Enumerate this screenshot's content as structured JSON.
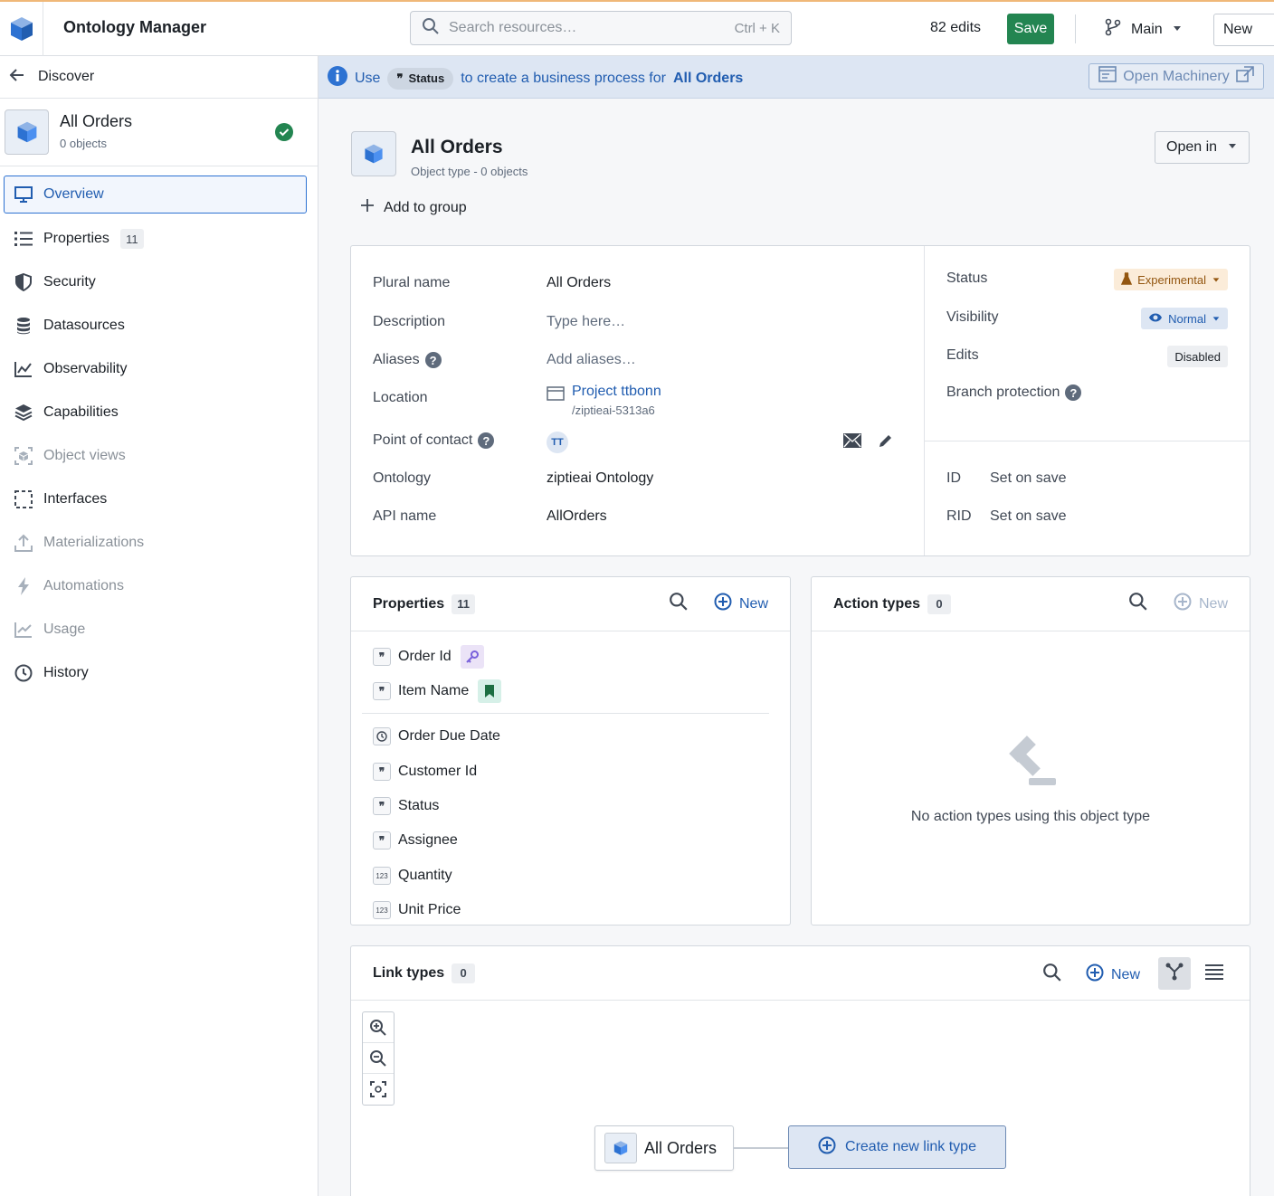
{
  "topbar": {
    "app_title": "Ontology Manager",
    "search_placeholder": "Search resources…",
    "search_shortcut": "Ctrl + K",
    "edits_count": "82 edits",
    "save_label": "Save",
    "branch_label": "Main",
    "new_label": "New"
  },
  "sidebar": {
    "back_label": "Discover",
    "object_name": "All Orders",
    "object_count": "0 objects",
    "items": [
      {
        "label": "Overview",
        "icon": "monitor-icon",
        "state": "active"
      },
      {
        "label": "Properties",
        "icon": "list-icon",
        "badge": "11"
      },
      {
        "label": "Security",
        "icon": "shield-icon"
      },
      {
        "label": "Datasources",
        "icon": "database-icon"
      },
      {
        "label": "Observability",
        "icon": "chart-icon"
      },
      {
        "label": "Capabilities",
        "icon": "layers-icon"
      },
      {
        "label": "Object views",
        "icon": "object-view-icon",
        "state": "disabled"
      },
      {
        "label": "Interfaces",
        "icon": "dashed-square-icon"
      },
      {
        "label": "Materializations",
        "icon": "upload-icon",
        "state": "disabled"
      },
      {
        "label": "Automations",
        "icon": "lightning-icon",
        "state": "disabled"
      },
      {
        "label": "Usage",
        "icon": "line-chart-icon",
        "state": "disabled"
      },
      {
        "label": "History",
        "icon": "clock-icon"
      }
    ]
  },
  "banner": {
    "prefix": "Use",
    "chip_label": "Status",
    "middle": "to create a business process for",
    "object": "All Orders",
    "machinery_label": "Open Machinery"
  },
  "header": {
    "title": "All Orders",
    "subtitle": "Object type - 0 objects",
    "open_in_label": "Open in",
    "add_group_label": "Add to group"
  },
  "info": {
    "plural_label": "Plural name",
    "plural_value": "All Orders",
    "description_label": "Description",
    "description_placeholder": "Type here…",
    "aliases_label": "Aliases",
    "aliases_placeholder": "Add aliases…",
    "location_label": "Location",
    "location_value": "Project ttbonn",
    "location_path": "/ziptieai-5313a6",
    "contact_label": "Point of contact",
    "contact_initials": "TT",
    "ontology_label": "Ontology",
    "ontology_value": "ziptieai Ontology",
    "api_label": "API name",
    "api_value": "AllOrders",
    "status_label": "Status",
    "status_value": "Experimental",
    "visibility_label": "Visibility",
    "visibility_value": "Normal",
    "edits_label": "Edits",
    "edits_value": "Disabled",
    "branch_protection_label": "Branch protection",
    "id_label": "ID",
    "id_value": "Set on save",
    "rid_label": "RID",
    "rid_value": "Set on save",
    "colors": {
      "experimental": "#935610",
      "normal": "#215db0"
    }
  },
  "properties": {
    "title": "Properties",
    "count": "11",
    "new_label": "New",
    "items": [
      {
        "name": "Order Id",
        "type": "string",
        "tag": "key-icon"
      },
      {
        "name": "Item Name",
        "type": "string",
        "tag": "bookmark-icon"
      },
      {
        "name": "Order Due Date",
        "type": "timestamp"
      },
      {
        "name": "Customer Id",
        "type": "string"
      },
      {
        "name": "Status",
        "type": "string"
      },
      {
        "name": "Assignee",
        "type": "string"
      },
      {
        "name": "Quantity",
        "type": "number"
      },
      {
        "name": "Unit Price",
        "type": "number"
      }
    ]
  },
  "actions": {
    "title": "Action types",
    "count": "0",
    "new_label": "New",
    "empty_text": "No action types using this object type"
  },
  "links": {
    "title": "Link types",
    "count": "0",
    "new_label": "New",
    "node_label": "All Orders",
    "create_label": "Create new link type"
  }
}
